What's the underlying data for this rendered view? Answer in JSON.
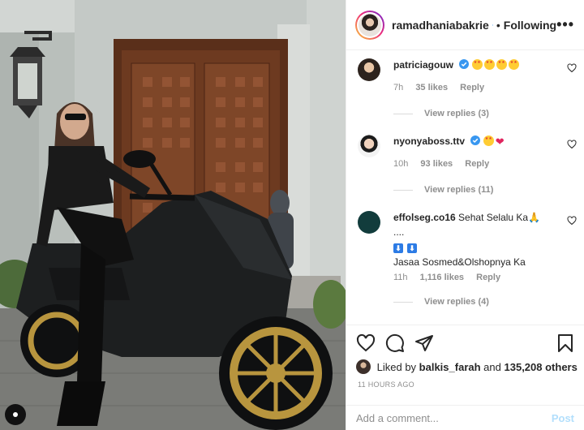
{
  "post": {
    "author": "ramadhaniabakrie",
    "follow_status": "Following",
    "more_label": "•••",
    "dot": "•"
  },
  "comments": [
    {
      "username": "patriciagouw",
      "verified": true,
      "text": "",
      "emojis": [
        "star-struck",
        "star-struck",
        "star-struck",
        "star-struck"
      ],
      "time": "7h",
      "likes": "35 likes",
      "reply_label": "Reply",
      "view_replies": "View replies (3)"
    },
    {
      "username": "nyonyaboss.ttv",
      "verified": true,
      "text": "",
      "emojis": [
        "star-struck",
        "red-heart"
      ],
      "time": "10h",
      "likes": "93 likes",
      "reply_label": "Reply",
      "view_replies": "View replies (11)"
    },
    {
      "username": "effolseg.co16",
      "verified": false,
      "text": "Sehat Selalu Ka",
      "text_extra": "....",
      "text_line2": "Jasaa Sosmed&Olshopnya Ka",
      "emojis": [
        "folded-hands"
      ],
      "time": "11h",
      "likes": "1,116 likes",
      "reply_label": "Reply",
      "view_replies": "View replies (4)"
    }
  ],
  "actions": {
    "icons": [
      "heart-icon",
      "comment-icon",
      "share-icon",
      "bookmark-icon"
    ],
    "liked_by_prefix": "Liked by",
    "liked_by_user": "balkis_farah",
    "liked_by_and": "and",
    "liked_by_count": "135,208 others",
    "timestamp": "11 HOURS AGO"
  },
  "add_comment": {
    "placeholder": "Add a comment...",
    "post_label": "Post"
  },
  "colors": {
    "verified": "#3897f0",
    "link_disabled": "#b2dffc",
    "muted": "#8e8e8e"
  }
}
